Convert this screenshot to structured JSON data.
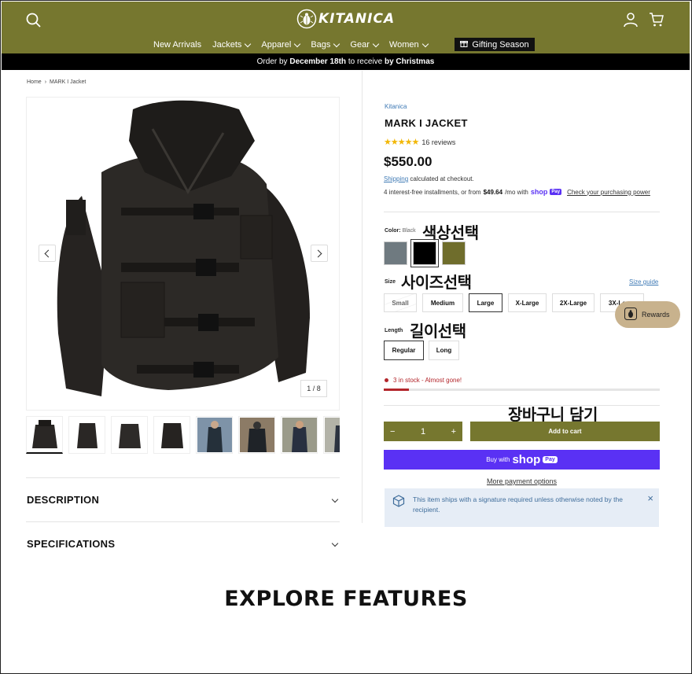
{
  "header": {
    "logo_text": "KITANICA",
    "nav": [
      {
        "label": "New Arrivals",
        "has_menu": false
      },
      {
        "label": "Jackets",
        "has_menu": true
      },
      {
        "label": "Apparel",
        "has_menu": true
      },
      {
        "label": "Bags",
        "has_menu": true
      },
      {
        "label": "Gear",
        "has_menu": true
      },
      {
        "label": "Women",
        "has_menu": true
      }
    ],
    "gifting_label": "Gifting Season",
    "icons": [
      "search-icon",
      "account-icon",
      "cart-icon",
      "gift-icon"
    ]
  },
  "promo": {
    "prefix": "Order by ",
    "date": "December 18th",
    "middle": " to receive ",
    "suffix": "by Christmas"
  },
  "breadcrumb": {
    "home": "Home",
    "current": "MARK I Jacket"
  },
  "gallery": {
    "counter": "1 / 8",
    "thumbnail_count": 8
  },
  "accordions": {
    "description": "DESCRIPTION",
    "specifications": "SPECIFICATIONS"
  },
  "explore_heading": "EXPLORE FEATURES",
  "product": {
    "vendor": "Kitanica",
    "title": "MARK I JACKET",
    "stars": "★★★★★",
    "rating": 5,
    "reviews": "16 reviews",
    "price": "$550.00",
    "shipping_link": "Shipping",
    "shipping_rest": " calculated at checkout.",
    "install_pre": "4 interest-free installments, or from ",
    "install_amount": "$49.64",
    "install_mid": "/mo with ",
    "install_shop": "shop",
    "install_pay": "Pay",
    "install_link": "Check your purchasing power"
  },
  "options": {
    "color_label": "Color:",
    "color_value": "Black",
    "color_note": "색상선택",
    "colors": [
      "#6f7a80",
      "#000000",
      "#6f6d2c"
    ],
    "selected_color_index": 1,
    "size_label": "Size",
    "size_note": "사이즈선택",
    "size_guide": "Size guide",
    "sizes": [
      "Small",
      "Medium",
      "Large",
      "X-Large",
      "2X-Large",
      "3X-Large"
    ],
    "selected_size": "Large",
    "unavailable_size": "Small",
    "length_label": "Length",
    "length_note": "길이선택",
    "lengths": [
      "Regular",
      "Long"
    ],
    "selected_length": "Regular"
  },
  "stock": {
    "text": "3 in stock - Almost gone!",
    "level": 0.09
  },
  "cart": {
    "cart_note": "장바구니 담기",
    "qty_minus": "−",
    "qty_value": "1",
    "qty_plus": "+",
    "add_label": "Add to cart",
    "buy_with": "Buy with",
    "shop_word": "shop",
    "pay_chip": "Pay",
    "more_payment": "More payment options"
  },
  "notice": {
    "text": "This item ships with a signature required unless otherwise noted by the recipient.",
    "close": "×"
  },
  "rewards": {
    "label": "Rewards"
  }
}
